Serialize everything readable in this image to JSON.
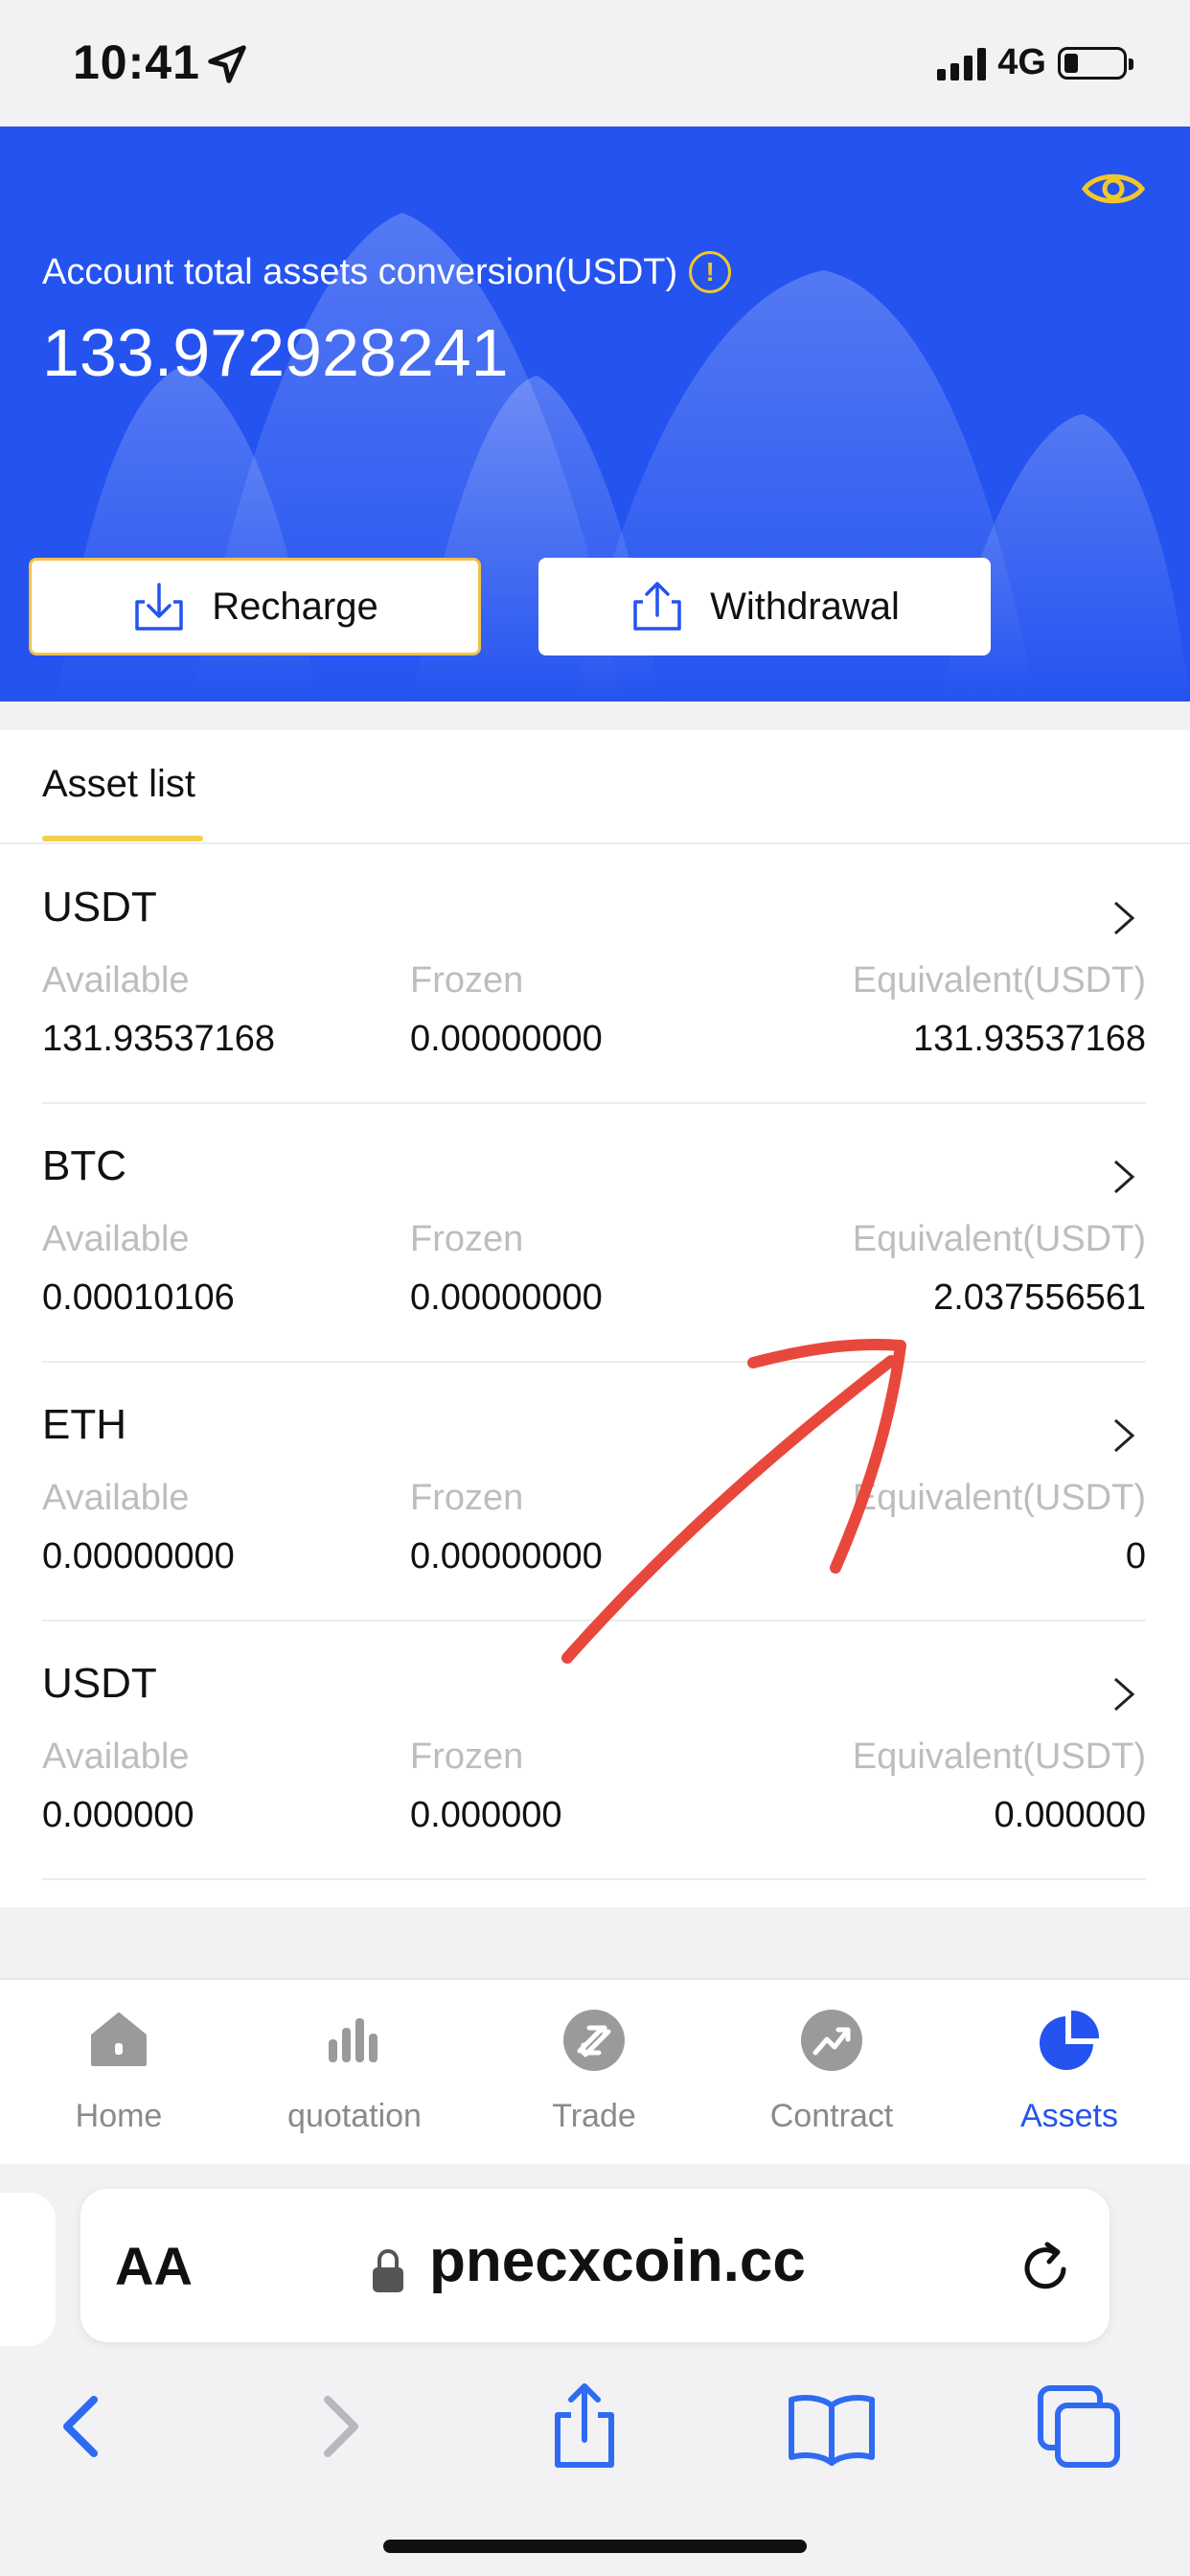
{
  "status_bar": {
    "time": "10:41",
    "network": "4G"
  },
  "header": {
    "total_label": "Account total assets conversion(USDT)",
    "info_icon_text": "!",
    "total_value": "133.972928241",
    "recharge_label": "Recharge",
    "withdrawal_label": "Withdrawal"
  },
  "asset_list": {
    "tab_label": "Asset list",
    "column_labels": {
      "available": "Available",
      "frozen": "Frozen",
      "equivalent": "Equivalent(USDT)"
    },
    "items": [
      {
        "name": "USDT",
        "available": "131.93537168",
        "frozen": "0.00000000",
        "equivalent": "131.93537168"
      },
      {
        "name": "BTC",
        "available": "0.00010106",
        "frozen": "0.00000000",
        "equivalent": "2.037556561"
      },
      {
        "name": "ETH",
        "available": "0.00000000",
        "frozen": "0.00000000",
        "equivalent": "0"
      },
      {
        "name": "USDT",
        "available": "0.000000",
        "frozen": "0.000000",
        "equivalent": "0.000000"
      }
    ]
  },
  "tabbar": {
    "items": [
      {
        "label": "Home",
        "icon": "home-icon"
      },
      {
        "label": "quotation",
        "icon": "bar-chart-icon"
      },
      {
        "label": "Trade",
        "icon": "trade-icon"
      },
      {
        "label": "Contract",
        "icon": "contract-icon"
      },
      {
        "label": "Assets",
        "icon": "pie-chart-icon"
      }
    ],
    "active": "Assets"
  },
  "browser": {
    "aa_label": "AA",
    "domain": "pnecxcoin.cc"
  },
  "colors": {
    "primary_blue": "#2453f0",
    "accent_yellow": "#f3c72a",
    "annotation_red": "#e8483c"
  }
}
